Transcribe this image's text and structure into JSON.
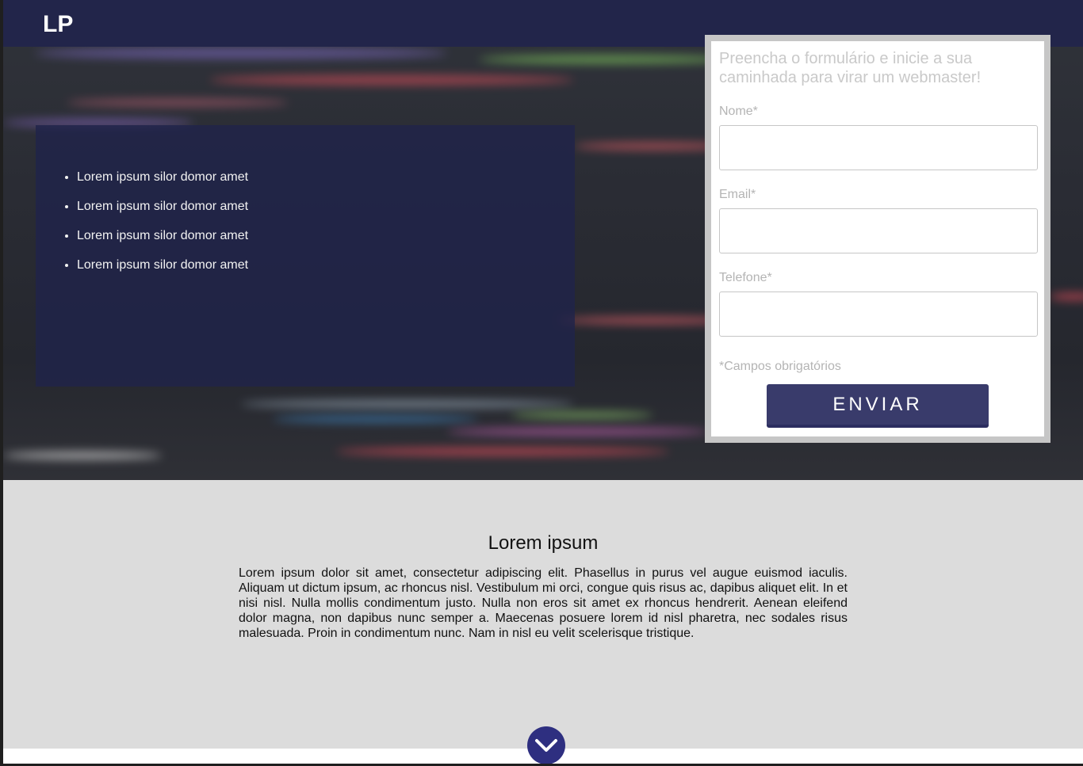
{
  "header": {
    "logo": "LP"
  },
  "hero": {
    "features": [
      "Lorem ipsum silor domor amet",
      "Lorem ipsum silor domor amet",
      "Lorem ipsum silor domor amet",
      "Lorem ipsum silor domor amet"
    ]
  },
  "form": {
    "title": "Preencha o formulário e inicie a sua caminhada para virar um webmaster!",
    "name_label": "Nome*",
    "email_label": "Email*",
    "phone_label": "Telefone*",
    "name_value": "",
    "email_value": "",
    "phone_value": "",
    "required_note": "*Campos obrigatórios",
    "submit_label": "ENVIAR"
  },
  "content": {
    "heading": "Lorem ipsum",
    "paragraph": "Lorem ipsum dolor sit amet, consectetur adipiscing elit. Phasellus in purus vel augue euismod iaculis. Aliquam ut dictum ipsum, ac rhoncus nisl. Vestibulum mi orci, congue quis risus ac, dapibus aliquet elit. In et nisi nisl. Nulla mollis condimentum justo. Nulla non eros sit amet ex rhoncus hendrerit. Aenean eleifend dolor magna, non dapibus nunc semper a. Maecenas posuere lorem id nisl pharetra, nec sodales risus malesuada. Proin in condimentum nunc. Nam in nisl eu velit scelerisque tristique."
  },
  "scroll_button": {
    "icon": "chevron-down-icon"
  },
  "colors": {
    "header_bg": "#22254a",
    "panel_bg": "#20234b",
    "accent": "#393b6b",
    "scroll_button": "#2e2f80",
    "section_bg": "#dcdcdc"
  }
}
